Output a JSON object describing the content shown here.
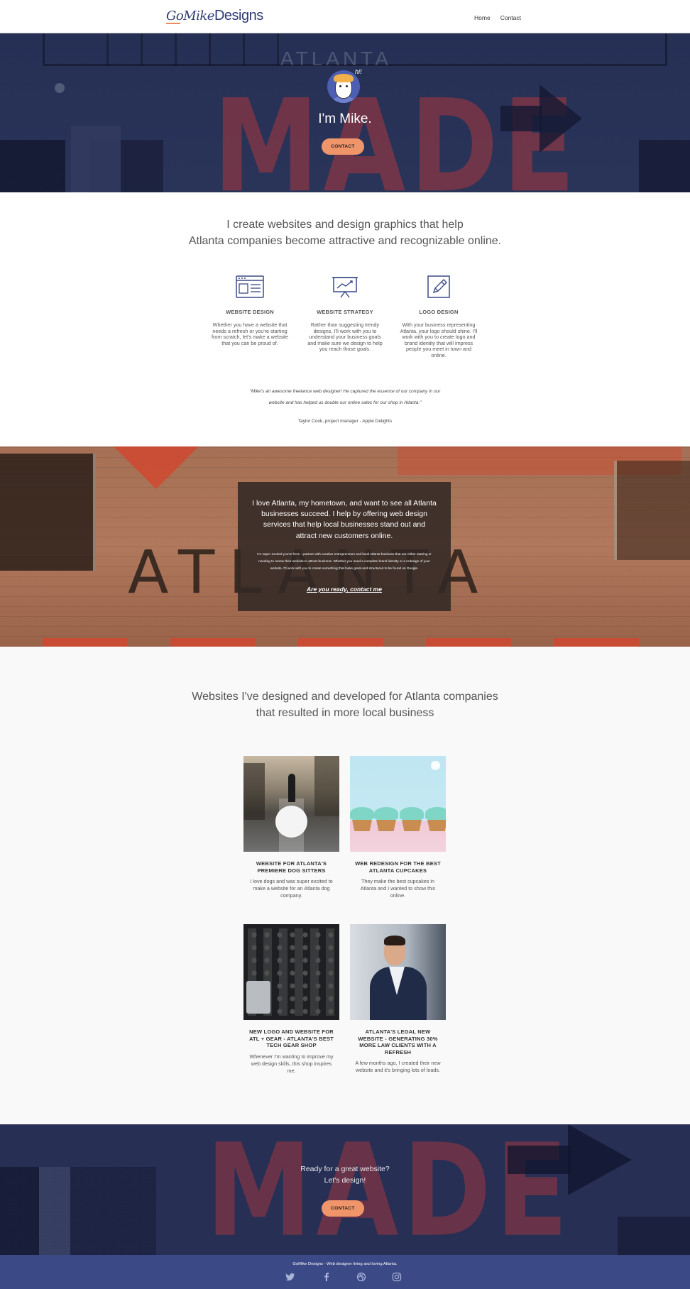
{
  "nav": {
    "logo_go": "GoMike",
    "logo_designs": "Designs",
    "links": [
      "Home",
      "Contact"
    ]
  },
  "hero": {
    "bg_atlanta": "ATLANTA",
    "bg_made": "MADE",
    "avatar_hi": "hi!",
    "title": "I'm Mike.",
    "button": "CONTACT"
  },
  "intro": {
    "line1": "I create websites and design graphics that help",
    "line2": "Atlanta companies become attractive and recognizable online."
  },
  "services": [
    {
      "icon": "browser-window-icon",
      "title": "WEBSITE DESIGN",
      "desc": "Whether you have a website that needs a refresh or you're starting from scratch, let's make a website that you can be proud of."
    },
    {
      "icon": "presentation-chart-icon",
      "title": "WEBSITE STRATEGY",
      "desc": "Rather than suggesting trendy designs, I'll work with you to understand your business goals and make sure we design to help you reach those goals."
    },
    {
      "icon": "pencil-edit-icon",
      "title": "LOGO DESIGN",
      "desc": "With your business representing Atlanta, your logo should shine. I'll work with you to create logo and brand identity that will impress people you meet in town and online."
    }
  ],
  "testimonial": {
    "quote": "\"Mike's an awesome freelance web designer! He captured the essence of our company in our website and has helped us double our online sales for our shop in Atlanta.\"",
    "author": "Taylor Cook, project manager - Apple Delights"
  },
  "atlanta_section": {
    "bg_word": "ATLANTA",
    "big_text": "I love Atlanta, my hometown, and want to see all Atlanta businesses succeed. I help by offering web design services that help local businesses stand out and attract new customers online.",
    "small_text": "I'm super excited you're here. I partner with creative entrepreneurs and local Atlanta business that are either starting or needing to renew their website to attract business. Whether you need a complete brand identity or a redesign of your website, I'll work with you to create something that looks great and structured to be found on Google.",
    "cta": "Are you ready, contact me"
  },
  "portfolio": {
    "title_line1": "Websites I've designed and developed for Atlanta companies",
    "title_line2": "that resulted in more local business",
    "items": [
      {
        "title": "WEBSITE FOR ATLANTA'S PREMIERE DOG SITTERS",
        "desc": "I love dogs and was super excited to make a website for an Atlanta dog company."
      },
      {
        "title": "WEB REDESIGN FOR THE BEST ATLANTA CUPCAKES",
        "desc": "They make the best cupcakes in Atlanta and I wanted to show this online."
      },
      {
        "title": "NEW LOGO AND WEBSITE FOR ATL + GEAR - ATLANTA'S BEST TECH GEAR SHOP",
        "desc": "Whenever I'm wanting to improve my web design skills, this shop inspires me."
      },
      {
        "title": "ATLANTA'S LEGAL NEW WEBSITE - GENERATING 30% MORE LAW CLIENTS WITH A REFRESH",
        "desc": "A few months ago, I created their new website and it's bringing lots of leads."
      }
    ]
  },
  "cta": {
    "bg_word": "MADE",
    "line1": "Ready for a great website?",
    "line2": "Let's design!",
    "button": "CONTACT"
  },
  "footer": {
    "text": "GoMike Designs - Web designer living and loving Atlanta.",
    "social": [
      "twitter-icon",
      "facebook-icon",
      "dribbble-icon",
      "instagram-icon"
    ]
  },
  "colors": {
    "accent": "#f0956a",
    "navy": "#2f3b73",
    "footer": "#3b4a87"
  }
}
